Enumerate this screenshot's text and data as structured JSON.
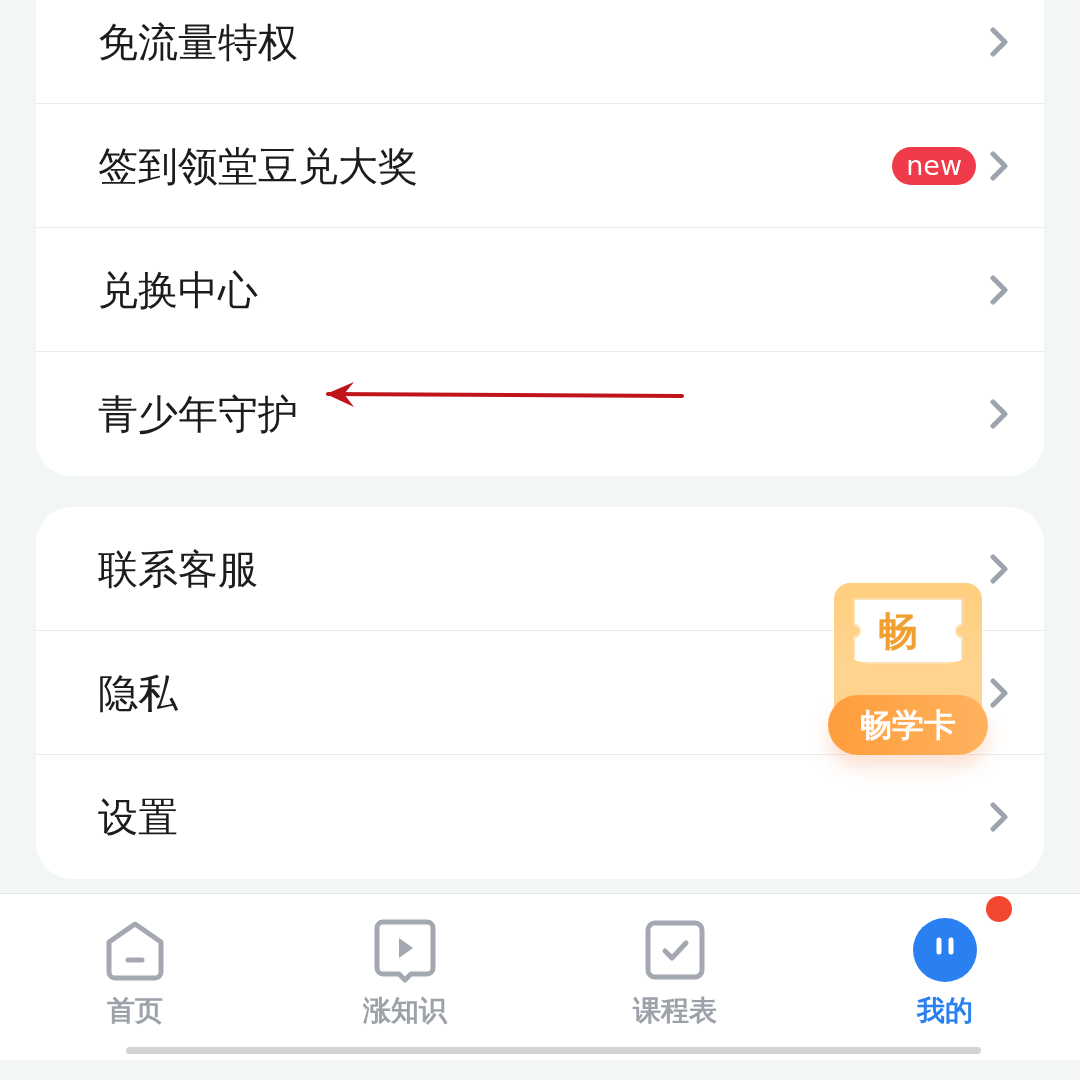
{
  "menu_groups": [
    {
      "items": [
        {
          "label": "免流量特权"
        },
        {
          "label": "签到领堂豆兑大奖",
          "badge": "new"
        },
        {
          "label": "兑换中心"
        },
        {
          "label": "青少年守护",
          "annotated": true
        }
      ]
    },
    {
      "items": [
        {
          "label": "联系客服"
        },
        {
          "label": "隐私"
        },
        {
          "label": "设置"
        }
      ]
    }
  ],
  "floating_card": {
    "icon_char": "畅",
    "label": "畅学卡"
  },
  "tab_bar": [
    {
      "kind": "home",
      "label": "首页",
      "selected": false,
      "dot": false
    },
    {
      "kind": "video",
      "label": "涨知识",
      "selected": false,
      "dot": false
    },
    {
      "kind": "check",
      "label": "课程表",
      "selected": false,
      "dot": false
    },
    {
      "kind": "avatar",
      "label": "我的",
      "selected": true,
      "dot": true
    }
  ]
}
